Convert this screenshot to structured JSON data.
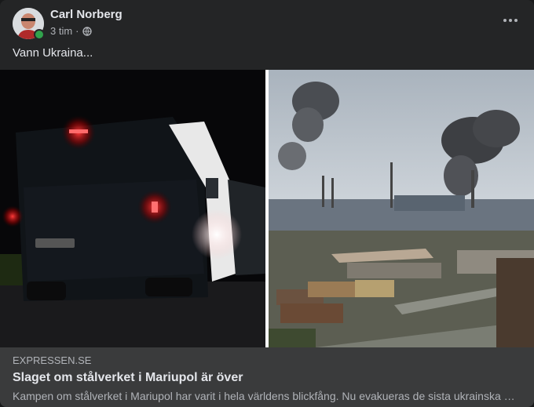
{
  "post": {
    "author": "Carl Norberg",
    "time": "3 tim",
    "separator": "·",
    "audience_icon": "globe-icon",
    "text": "Vann Ukraina...",
    "more_icon": "more-horizontal-icon"
  },
  "link_preview": {
    "domain": "EXPRESSEN.SE",
    "title": "Slaget om stålverket i Mariupol är över",
    "description": "Kampen om stålverket i Mariupol har varit i hela världens blickfång. Nu evakueras de sista ukrainska soldaterna."
  },
  "colors": {
    "card_bg": "#242526",
    "link_bg": "#3a3b3c",
    "primary_text": "#e4e6eb",
    "secondary_text": "#b0b3b8",
    "online": "#31a24c"
  }
}
